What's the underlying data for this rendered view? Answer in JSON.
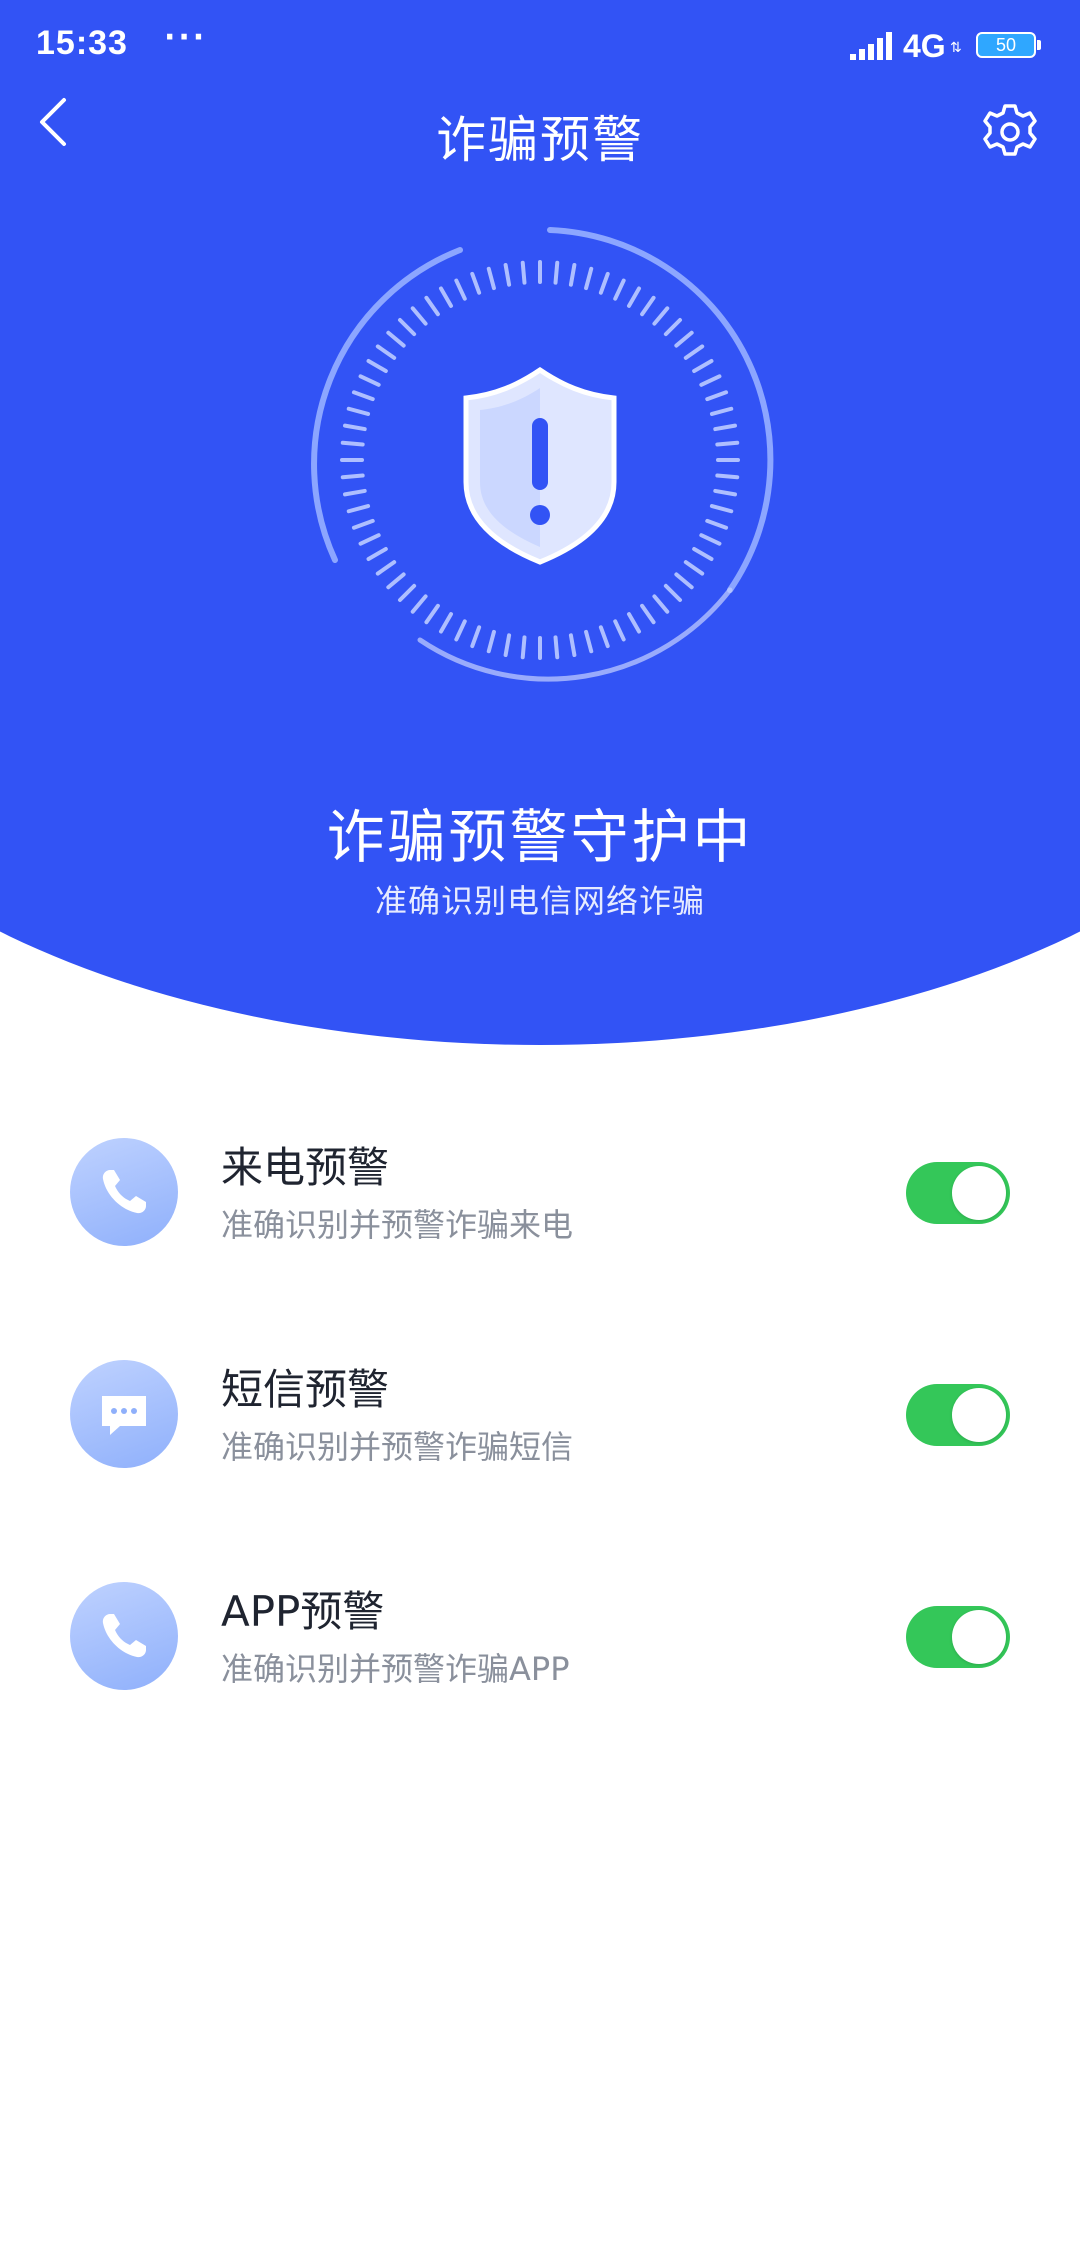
{
  "status_bar": {
    "time": "15:33",
    "dots": "···",
    "network": "4G",
    "battery": "50"
  },
  "header": {
    "title": "诈骗预警"
  },
  "hero": {
    "title": "诈骗预警守护中",
    "subtitle": "准确识别电信网络诈骗"
  },
  "features": [
    {
      "title": "来电预警",
      "desc": "准确识别并预警诈骗来电",
      "icon": "phone-icon",
      "enabled": true
    },
    {
      "title": "短信预警",
      "desc": "准确识别并预警诈骗短信",
      "icon": "message-icon",
      "enabled": true
    },
    {
      "title": "APP预警",
      "desc": "准确识别并预警诈骗APP",
      "icon": "phone-icon",
      "enabled": true
    }
  ],
  "colors": {
    "primary": "#3253f5",
    "toggle_on": "#34c759"
  }
}
